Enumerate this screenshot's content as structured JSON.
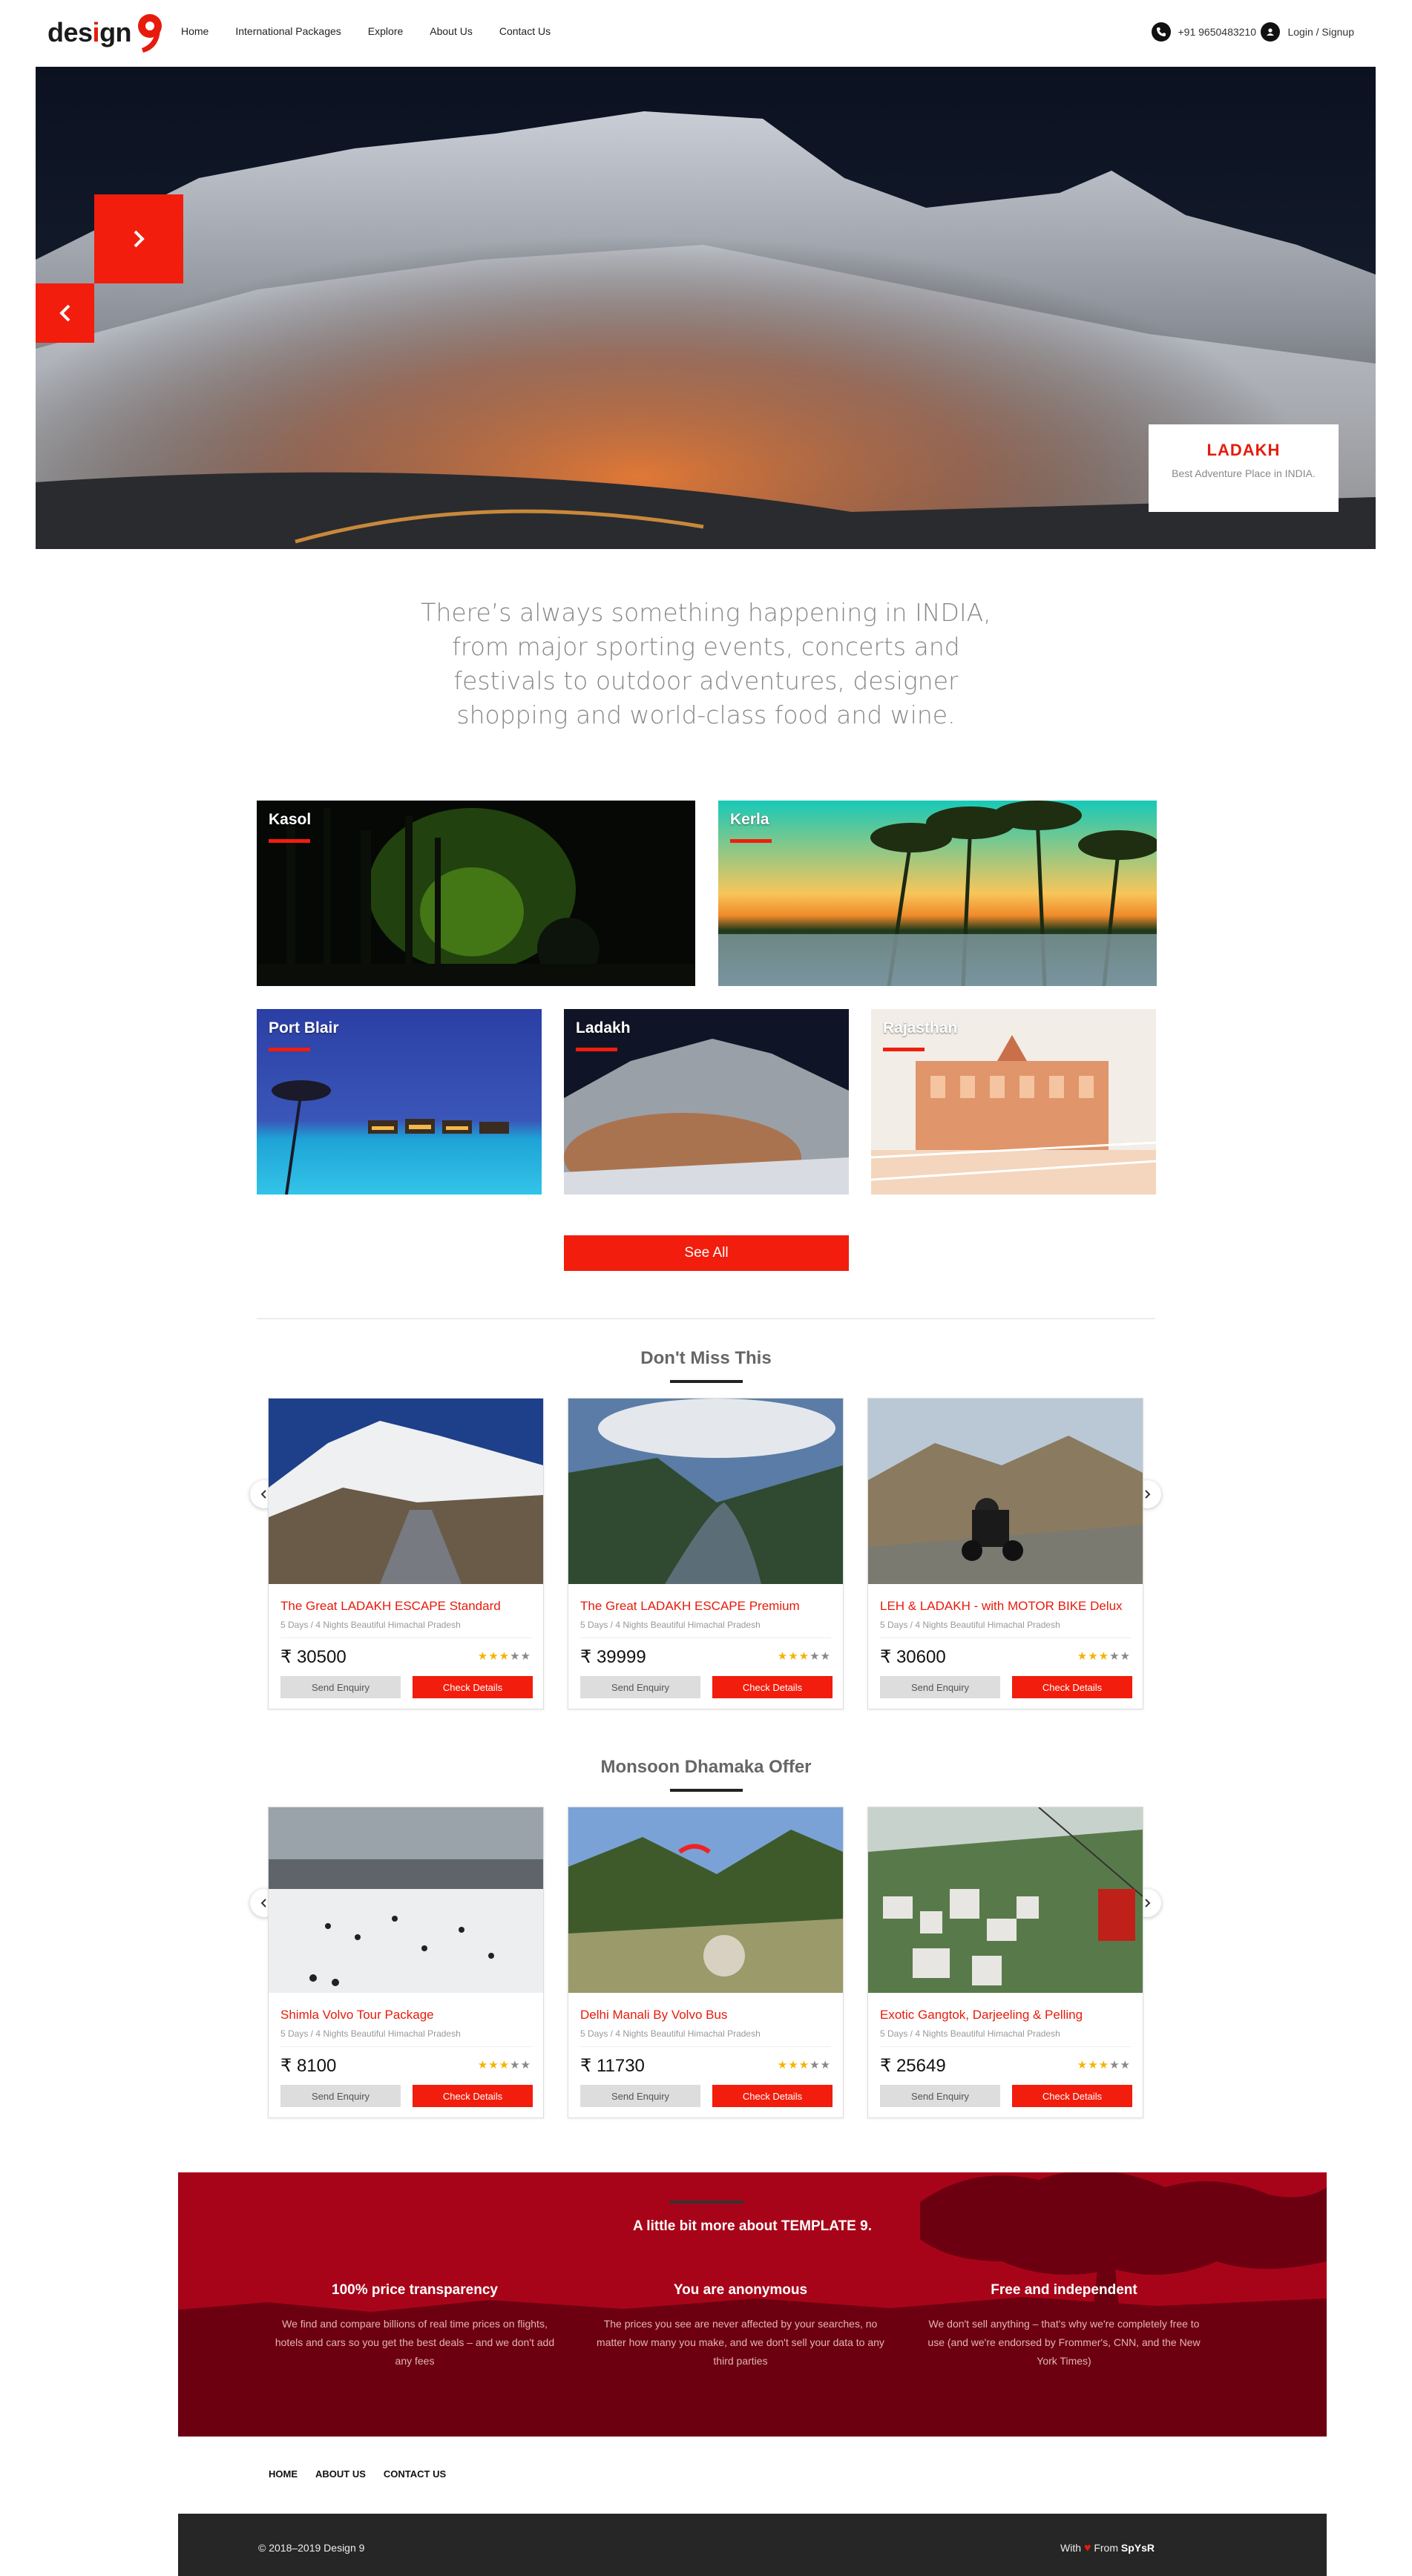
{
  "header": {
    "logo_text": "design",
    "logo_number": "9",
    "nav": [
      "Home",
      "International Packages",
      "Explore",
      "About Us",
      "Contact Us"
    ],
    "phone": "+91 9650483210",
    "login_label": "Login / Signup"
  },
  "hero": {
    "caption_title": "LADAKH",
    "caption_subtitle": "Best Adventure Place in INDIA."
  },
  "intro": "There’s always something happening in INDIA, from major sporting events, concerts and festivals to outdoor adventures, designer shopping and world-class food and wine.",
  "destinations": [
    "Kasol",
    "Kerla",
    "Port Blair",
    "Ladakh",
    "Rajasthan"
  ],
  "see_all_label": "See All",
  "sections": [
    {
      "title": "Don't Miss This",
      "cards": [
        {
          "title": "The Great LADAKH ESCAPE Standard",
          "sub": "5 Days / 4 Nights Beautiful Himachal Pradesh",
          "price": "₹ 30500",
          "rating": 3
        },
        {
          "title": "The Great LADAKH ESCAPE Premium",
          "sub": "5 Days / 4 Nights Beautiful Himachal Pradesh",
          "price": "₹ 39999",
          "rating": 3
        },
        {
          "title": "LEH & LADAKH - with MOTOR BIKE Delux",
          "sub": "5 Days / 4 Nights Beautiful Himachal Pradesh",
          "price": "₹ 30600",
          "rating": 3
        }
      ]
    },
    {
      "title": "Monsoon Dhamaka Offer",
      "cards": [
        {
          "title": "Shimla Volvo Tour Package",
          "sub": "5 Days / 4 Nights Beautiful Himachal Pradesh",
          "price": "₹ 8100",
          "rating": 3
        },
        {
          "title": "Delhi Manali By Volvo Bus",
          "sub": "5 Days / 4 Nights Beautiful Himachal Pradesh",
          "price": "₹ 11730",
          "rating": 3
        },
        {
          "title": "Exotic Gangtok, Darjeeling & Pelling",
          "sub": "5 Days / 4 Nights Beautiful Himachal Pradesh",
          "price": "₹ 25649",
          "rating": 3
        }
      ]
    }
  ],
  "card_buttons": {
    "enquiry": "Send Enquiry",
    "details": "Check Details"
  },
  "about": {
    "heading": "A little bit more about TEMPLATE 9.",
    "features": [
      {
        "title": "100% price transparency",
        "desc": "We find and compare billions of real time prices on flights, hotels and cars so you get the best deals – and we don't add any fees"
      },
      {
        "title": "You are anonymous",
        "desc": "The prices you see are never affected by your searches, no matter how many you make, and we don't sell your data to any third parties"
      },
      {
        "title": "Free and independent",
        "desc": "We don't sell anything – that's why we're completely free to use (and we're endorsed by Frommer's, CNN, and the New York Times)"
      }
    ]
  },
  "footer": {
    "nav": [
      "HOME",
      "ABOUT US",
      "CONTACT US"
    ],
    "copyright": "© 2018–2019 Design 9",
    "made_with": "With",
    "made_from": "From",
    "author": "SpYsR"
  },
  "colors": {
    "accent": "#f21d0c",
    "band": "#a50016",
    "footer": "#262626"
  }
}
